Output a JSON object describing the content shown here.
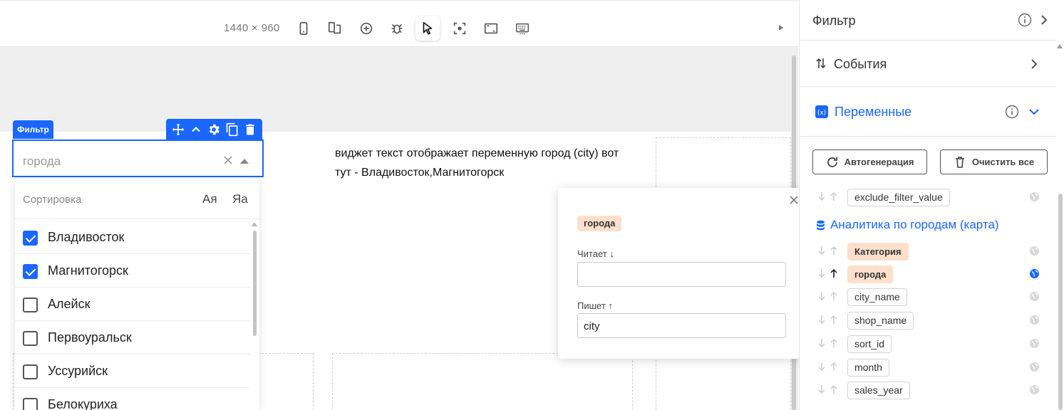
{
  "toolbar": {
    "dimensions": "1440 × 960",
    "tools": [
      "mobile-icon",
      "responsive-icon",
      "zoom-icon",
      "bug-icon",
      "cursor-icon",
      "focus-icon",
      "frame-icon",
      "keyboard-icon"
    ],
    "active_tool": "cursor-icon"
  },
  "canvas": {
    "text_widget": "виджет текст отображает переменную город (city) вот тут - Владивосток,Магнитогорск"
  },
  "filter_widget": {
    "tag": "Фильтр",
    "placeholder": "города",
    "sort_label": "Сортировка",
    "sort_az": "Ая",
    "sort_za": "Яа",
    "items": [
      {
        "label": "Владивосток",
        "checked": true
      },
      {
        "label": "Магнитогорск",
        "checked": true
      },
      {
        "label": "Алейск",
        "checked": false
      },
      {
        "label": "Первоуральск",
        "checked": false
      },
      {
        "label": "Уссурийск",
        "checked": false
      },
      {
        "label": "Белокуриха",
        "checked": false
      }
    ]
  },
  "popover": {
    "variable": "города",
    "reads_label": "Читает ↓",
    "reads_value": "",
    "writes_label": "Пишет ↑",
    "writes_value": "city"
  },
  "panel": {
    "filter_title": "Фильтр",
    "events_title": "События",
    "variables_title": "Переменные",
    "autogen_label": "Автогенерация",
    "clear_all_label": "Очистить все",
    "top_variable": "exclude_filter_value",
    "dataset_title": "Аналитика по городам (карта)",
    "variables": [
      {
        "name": "Категория",
        "highlight": true,
        "writes": false,
        "global_active": false
      },
      {
        "name": "города",
        "highlight": true,
        "writes": true,
        "global_active": true
      },
      {
        "name": "city_name",
        "highlight": false,
        "writes": false,
        "global_active": false
      },
      {
        "name": "shop_name",
        "highlight": false,
        "writes": false,
        "global_active": false
      },
      {
        "name": "sort_id",
        "highlight": false,
        "writes": false,
        "global_active": false
      },
      {
        "name": "month",
        "highlight": false,
        "writes": false,
        "global_active": false
      },
      {
        "name": "sales_year",
        "highlight": false,
        "writes": false,
        "global_active": false
      }
    ],
    "accent_color": "#1a66ff",
    "chip_color": "#fde0cc"
  }
}
